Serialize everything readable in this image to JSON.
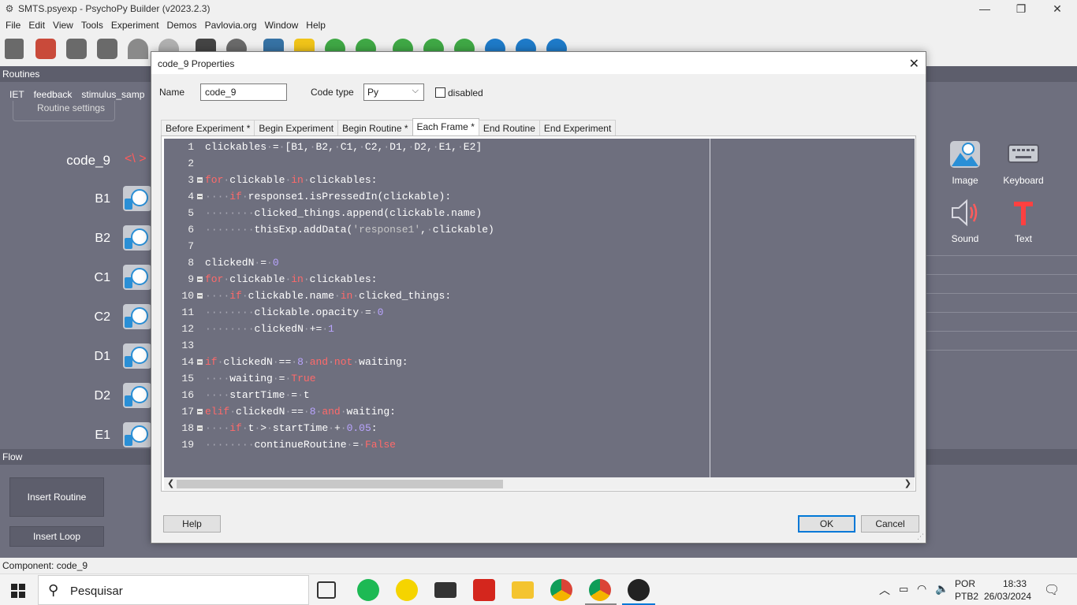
{
  "window": {
    "title": "SMTS.psyexp - PsychoPy Builder (v2023.2.3)"
  },
  "menu": [
    "File",
    "Edit",
    "View",
    "Tools",
    "Experiment",
    "Demos",
    "Pavlovia.org",
    "Window",
    "Help"
  ],
  "routines": {
    "header": "Routines",
    "tabs": [
      "IET",
      "feedback",
      "stimulus_samp"
    ],
    "settings_label": "Routine settings",
    "components": [
      "code_9",
      "B1",
      "B2",
      "C1",
      "C2",
      "D1",
      "D2",
      "E1"
    ]
  },
  "palette": {
    "items": [
      {
        "label": "Image",
        "icon": "image-icon"
      },
      {
        "label": "Keyboard",
        "icon": "keyboard-icon"
      },
      {
        "label": "Sound",
        "icon": "speaker-icon"
      },
      {
        "label": "Text",
        "icon": "text-t-icon"
      }
    ]
  },
  "flow": {
    "header": "Flow",
    "insert_routine": "Insert Routine",
    "insert_loop": "Insert Loop"
  },
  "status": "Component: code_9",
  "taskbar": {
    "search_placeholder": "Pesquisar",
    "lang_top": "POR",
    "lang_bottom": "PTB2",
    "time": "18:33",
    "date": "26/03/2024"
  },
  "dialog": {
    "title": "code_9 Properties",
    "name_label": "Name",
    "name_value": "code_9",
    "code_type_label": "Code type",
    "code_type_value": "Py",
    "disabled_label": "disabled",
    "tabs": [
      "Before Experiment *",
      "Begin Experiment",
      "Begin Routine *",
      "Each Frame *",
      "End Routine",
      "End Experiment"
    ],
    "active_tab": "Each Frame *",
    "help": "Help",
    "ok": "OK",
    "cancel": "Cancel"
  },
  "code_lines": [
    "clickables = [B1, B2, C1, C2, D1, D2, E1, E2]",
    "",
    "for clickable in clickables:",
    "    if response1.isPressedIn(clickable):",
    "        clicked_things.append(clickable.name)",
    "        thisExp.addData('response1', clickable)",
    "",
    "clickedN = 0",
    "for clickable in clickables:",
    "    if clickable.name in clicked_things:",
    "        clickable.opacity = 0",
    "        clickedN += 1",
    "",
    "if clickedN == 8 and not waiting:",
    "    waiting = True",
    "    startTime = t",
    "elif clickedN == 8 and waiting:",
    "    if t > startTime + 0.05:",
    "        continueRoutine = False"
  ],
  "colors": {
    "canvas": "#6e6f7e",
    "keyword": "#ff6a6a",
    "number": "#b9a4ff",
    "accent": "#0078d7"
  }
}
